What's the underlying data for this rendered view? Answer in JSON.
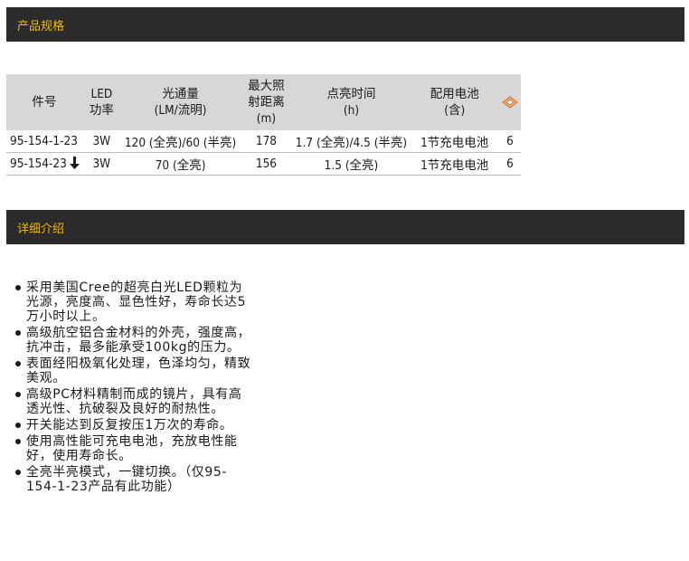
{
  "sections": {
    "spec_title": "产品规格",
    "detail_title": "详细介绍"
  },
  "table": {
    "headers": {
      "part": "件号",
      "power_1": "LED",
      "power_2": "功率",
      "flux_1": "光通量",
      "flux_2": "(LM/流明)",
      "range_1": "最大照",
      "range_2": "射距离",
      "range_3": "(m)",
      "time_1": "点亮时间",
      "time_2": "(h)",
      "battery_1": "配用电池",
      "battery_2": "(含)"
    },
    "rows": [
      {
        "part": "95-154-1-23",
        "power": "3W",
        "flux": "120 (全亮)/60 (半亮)",
        "range": "178",
        "time": "1.7 (全亮)/4.5 (半亮)",
        "battery": "1节充电电池",
        "qty": "6",
        "arrow": false
      },
      {
        "part": "95-154-23",
        "power": "3W",
        "flux": "70 (全亮)",
        "range": "156",
        "time": "1.5 (全亮)",
        "battery": "1节充电电池",
        "qty": "6",
        "arrow": true
      }
    ]
  },
  "features": [
    "采用美国Cree的超亮白光LED颗粒为光源，亮度高、显色性好，寿命长达5万小时以上。",
    "高级航空铝合金材料的外壳，强度高，抗冲击，最多能承受100kg的压力。",
    "表面经阳极氧化处理，色泽均匀，精致美观。",
    "高级PC材料精制而成的镜片，具有高透光性、抗破裂及良好的耐热性。",
    "开关能达到反复按压1万次的寿命。",
    "使用高性能可充电电池，充放电性能好，使用寿命长。",
    "全亮半亮模式，一键切换。（仅95-154-1-23产品有此功能）"
  ],
  "colors": {
    "bar_bg": "#2b2b2b",
    "bar_text": "#f5b800",
    "header_bg": "#d7d7d7"
  }
}
